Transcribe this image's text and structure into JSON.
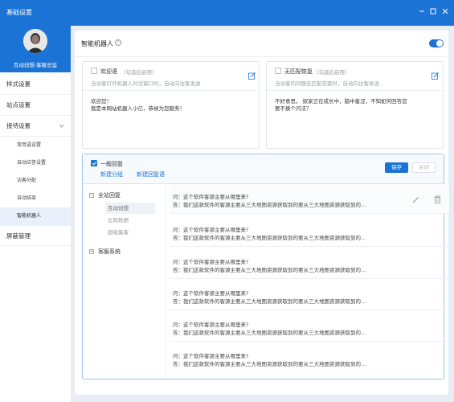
{
  "window": {
    "title": "基础设置",
    "controls": [
      "minimize-icon",
      "maximize-icon",
      "close-icon"
    ]
  },
  "profile": {
    "name": "互动创想-客服总监"
  },
  "sidebar": {
    "items": [
      {
        "label": "样式设置"
      },
      {
        "label": "站点设置"
      },
      {
        "label": "接待设置",
        "expanded": true
      },
      {
        "label": "屏蔽管理"
      }
    ],
    "sub_items": [
      {
        "label": "常用语设置"
      },
      {
        "label": "自动应答设置"
      },
      {
        "label": "访客分配"
      },
      {
        "label": "自动结束"
      },
      {
        "label": "智能机器人",
        "active": true
      }
    ]
  },
  "main": {
    "title": "智能机器人",
    "help_icon": "?",
    "toggle_on": true,
    "accent": "#1c73d6"
  },
  "welcome": {
    "title": "欢迎语",
    "hint": "（勾选后启用）",
    "desc": "当访客打开机器人对话窗口时，自动向访客发送",
    "text_line1": "欢迎您！",
    "text_line2": "我是本网站机器人小亿，恭候为您服务！"
  },
  "nomatch": {
    "title": "无匹配恢复",
    "hint": "（勾选后启用）",
    "desc": "当访客的问题无匹配答案时，自动向访客发送",
    "text_line1": "不好意思， 奴家正在成长中，脑中羞涩，不知如何回答您",
    "text_line2": "要不换个问法？"
  },
  "qa_panel": {
    "title": "一般回复",
    "add_group": "新建分组",
    "add_reply": "新建回复语",
    "save_label": "保存",
    "close_label": "关闭",
    "tree": {
      "group1": "全站回复",
      "group1_children": [
        "互动创想",
        "云知数据",
        "超级集客"
      ],
      "group2": "客服系统"
    },
    "items": [
      {
        "q": "问：这个软件客源主要从哪里来?",
        "a": "答：我们这款软件的客源主要从三大地图资源获取到的要从三大地图资源获取到的..."
      },
      {
        "q": "问：这个软件客源主要从哪里来?",
        "a": "答：我们这款软件的客源主要从三大地图资源获取到的要从三大地图资源获取到的..."
      },
      {
        "q": "问：这个软件客源主要从哪里来?",
        "a": "答：我们这款软件的客源主要从三大地图资源获取到的要从三大地图资源获取到的..."
      },
      {
        "q": "问：这个软件客源主要从哪里来?",
        "a": "答：我们这款软件的客源主要从三大地图资源获取到的要从三大地图资源获取到的..."
      },
      {
        "q": "问：这个软件客源主要从哪里来?",
        "a": "答：我们这款软件的客源主要从三大地图资源获取到的要从三大地图资源获取到的..."
      },
      {
        "q": "问：这个软件客源主要从哪里来?",
        "a": "答：我们这款软件的客源主要从三大地图资源获取到的要从三大地图资源获取到的..."
      }
    ]
  }
}
